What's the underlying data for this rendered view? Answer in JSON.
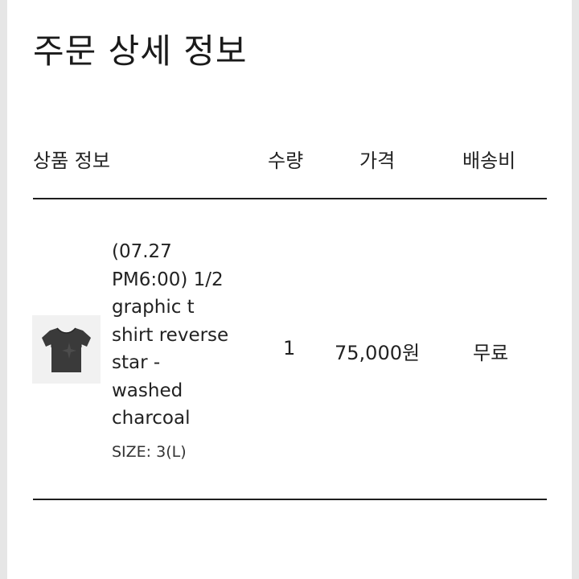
{
  "page_title": "주문 상세 정보",
  "table": {
    "headers": {
      "product": "상품 정보",
      "quantity": "수량",
      "price": "가격",
      "shipping": "배송비"
    },
    "rows": [
      {
        "product_name_lines": [
          "(07.27",
          "PM6:00) 1/2",
          "graphic t",
          "shirt reverse",
          "star -",
          "washed",
          "charcoal"
        ],
        "size": "SIZE: 3(L)",
        "quantity": "1",
        "price": "75,000원",
        "shipping": "무료",
        "thumbnail_icon": "charcoal-tshirt-image"
      }
    ]
  },
  "colors": {
    "background": "#e6e6e6",
    "panel": "#ffffff",
    "text": "#222222",
    "rule": "#1e1e1e",
    "shirt": "#3a3a3a"
  }
}
